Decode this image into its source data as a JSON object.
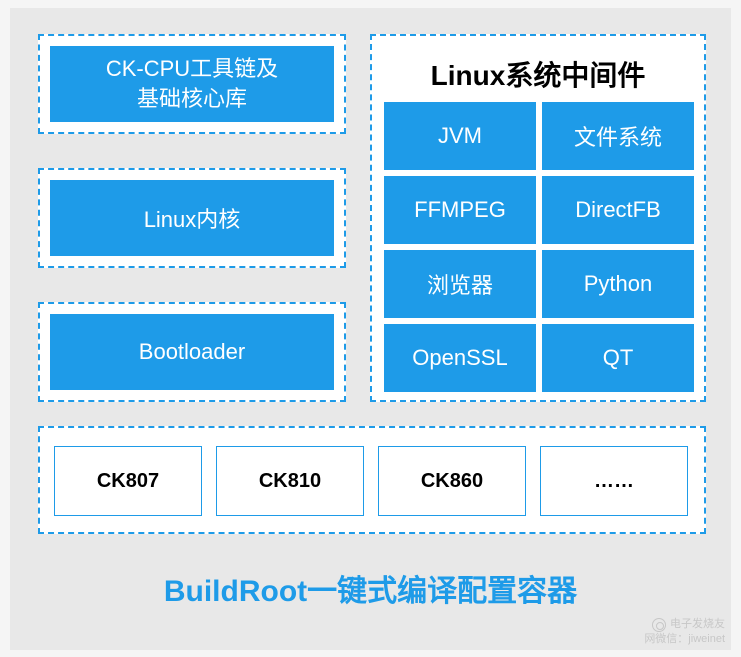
{
  "left_blocks": {
    "toolchain": "CK-CPU工具链及\n基础核心库",
    "kernel": "Linux内核",
    "bootloader": "Bootloader"
  },
  "middleware": {
    "title": "Linux系统中间件",
    "grid": [
      [
        "JVM",
        "文件系统"
      ],
      [
        "FFMPEG",
        "DirectFB"
      ],
      [
        "浏览器",
        "Python"
      ],
      [
        "OpenSSL",
        "QT"
      ]
    ]
  },
  "chips": [
    "CK807",
    "CK810",
    "CK860",
    "……"
  ],
  "footer": "BuildRoot一键式编译配置容器",
  "watermark": {
    "line1": "电子发烧友",
    "line2": "网微信：jiweinet"
  },
  "colors": {
    "accent": "#1e9be8",
    "canvas_bg": "#e8e8e8"
  }
}
